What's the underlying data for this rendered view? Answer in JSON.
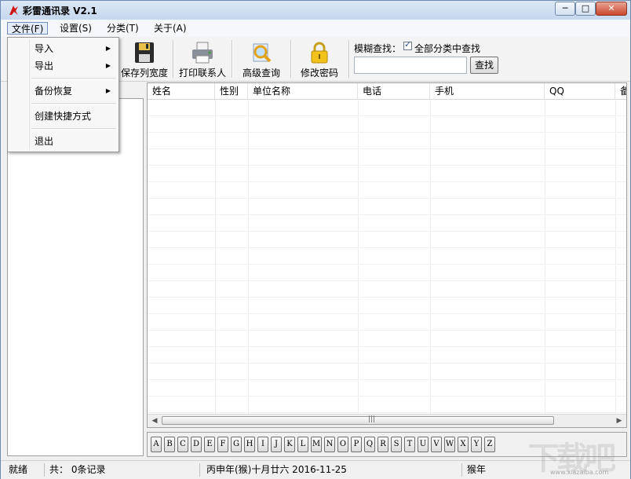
{
  "window": {
    "title": "彩雷通讯录 V2.1",
    "controls": {
      "minimize": "─",
      "maximize": "□",
      "close": "✕"
    }
  },
  "menubar": {
    "items": [
      {
        "label": "文件(F)",
        "active": true
      },
      {
        "label": "设置(S)"
      },
      {
        "label": "分类(T)"
      },
      {
        "label": "关于(A)"
      }
    ]
  },
  "file_menu": {
    "items": [
      {
        "label": "导入",
        "submenu": true
      },
      {
        "label": "导出",
        "submenu": true
      },
      {
        "label": "备份恢复",
        "submenu": true
      },
      {
        "label": "创建快捷方式"
      },
      {
        "label": "退出"
      }
    ],
    "submenu_arrow": "▶"
  },
  "toolbar": {
    "buttons": [
      {
        "label": "保存列宽度",
        "icon": "floppy-disk-icon"
      },
      {
        "label": "打印联系人",
        "icon": "printer-icon"
      },
      {
        "label": "高级查询",
        "icon": "magnifier-icon"
      },
      {
        "label": "修改密码",
        "icon": "padlock-icon"
      }
    ]
  },
  "search": {
    "label": "模糊查找：",
    "checkbox_label": "全部分类中查找",
    "checkbox_checked": true,
    "input_value": "",
    "button_label": "查找"
  },
  "grid": {
    "columns": [
      "姓名",
      "性别",
      "单位名称",
      "电话",
      "手机",
      "QQ",
      "备"
    ],
    "rows": [],
    "scroll_grip": "|||"
  },
  "alphabet": [
    "A",
    "B",
    "C",
    "D",
    "E",
    "F",
    "G",
    "H",
    "I",
    "J",
    "K",
    "L",
    "M",
    "N",
    "O",
    "P",
    "Q",
    "R",
    "S",
    "T",
    "U",
    "V",
    "W",
    "X",
    "Y",
    "Z"
  ],
  "statusbar": {
    "status": "就绪",
    "count": "共： 0条记录",
    "lunar_date": "丙申年(猴)十月廿六 2016-11-25",
    "zodiac": "猴年"
  },
  "watermark": {
    "text": "下载吧",
    "url": "www.xiazaiba.com"
  },
  "colors": {
    "title_bar": "#c6d8ee",
    "close_button": "#c9462c",
    "menu_active": "#e3ecf8"
  }
}
